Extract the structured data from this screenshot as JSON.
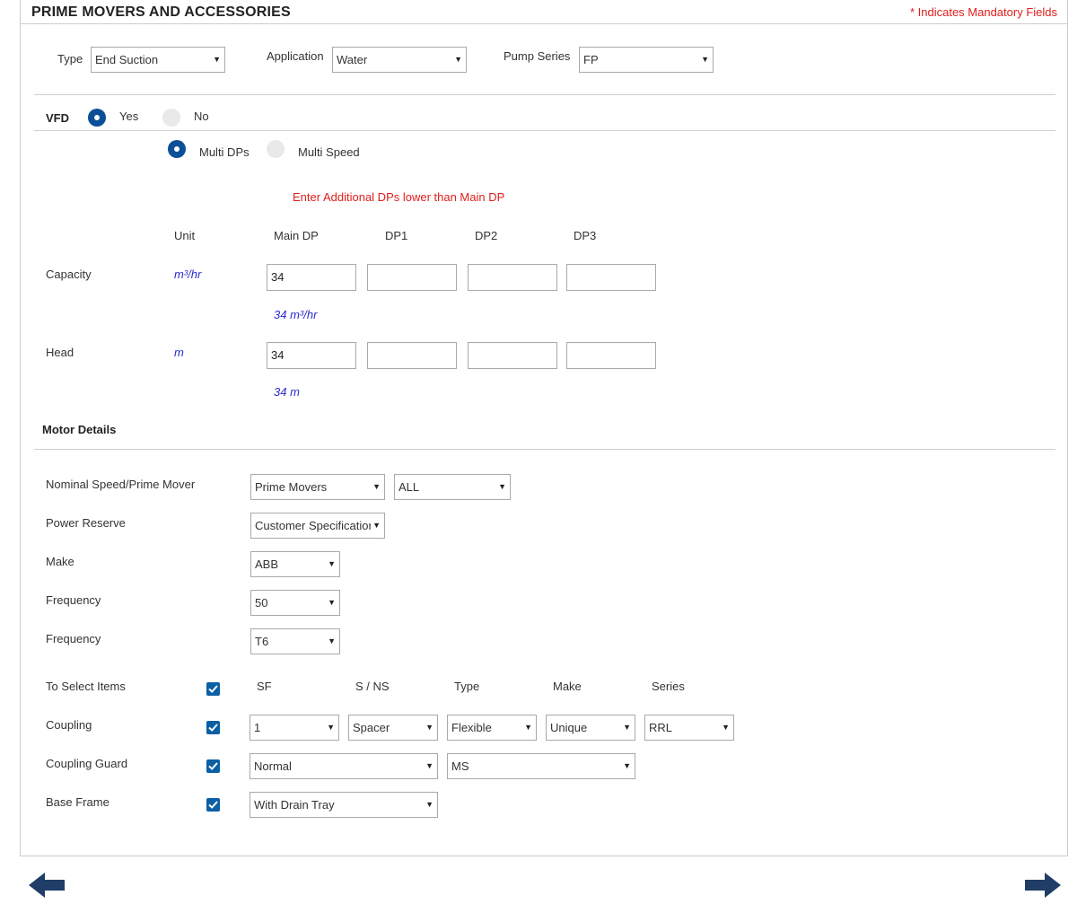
{
  "header": {
    "title": "PRIME MOVERS AND ACCESSORIES",
    "mandatory_note": "* Indicates Mandatory Fields"
  },
  "filters": {
    "type": {
      "label": "Type",
      "value": "End Suction"
    },
    "application": {
      "label": "Application",
      "value": "Water"
    },
    "pump_series": {
      "label": "Pump Series",
      "value": "FP"
    }
  },
  "vfd": {
    "label": "VFD",
    "yes_label": "Yes",
    "no_label": "No",
    "selected": "Yes",
    "mode_multi_dps": "Multi DPs",
    "mode_multi_speed": "Multi Speed",
    "mode_selected": "Multi DPs"
  },
  "dp_table": {
    "warning": "Enter Additional DPs lower than Main DP",
    "headers": {
      "unit": "Unit",
      "main": "Main DP",
      "dp1": "DP1",
      "dp2": "DP2",
      "dp3": "DP3"
    },
    "capacity": {
      "label": "Capacity",
      "unit": "m³/hr",
      "main": "34",
      "dp1": "",
      "dp2": "",
      "dp3": "",
      "hint": "34 m³/hr"
    },
    "head": {
      "label": "Head",
      "unit": "m",
      "main": "34",
      "dp1": "",
      "dp2": "",
      "dp3": "",
      "hint": "34 m"
    }
  },
  "motor": {
    "section_title": "Motor Details",
    "nominal_speed": {
      "label": "Nominal Speed/Prime Mover",
      "value1": "Prime Movers",
      "value2": "ALL"
    },
    "power_reserve": {
      "label": "Power Reserve",
      "value": "Customer Specification"
    },
    "make": {
      "label": "Make",
      "value": "ABB"
    },
    "frequency": {
      "label": "Frequency",
      "value": "50"
    },
    "frequency2": {
      "label": "Frequency",
      "value": "T6"
    }
  },
  "accessories": {
    "select_label": "To Select Items",
    "headers": {
      "sf": "SF",
      "sns": "S / NS",
      "type": "Type",
      "make": "Make",
      "series": "Series"
    },
    "coupling": {
      "label": "Coupling",
      "checked": true,
      "sf": "1",
      "sns": "Spacer",
      "type": "Flexible",
      "make": "Unique",
      "series": "RRL"
    },
    "coupling_guard": {
      "label": "Coupling Guard",
      "checked": true,
      "value1": "Normal",
      "value2": "MS"
    },
    "base_frame": {
      "label": "Base Frame",
      "checked": true,
      "value": "With Drain Tray"
    }
  },
  "icons": {
    "back": "left-arrow-icon",
    "next": "right-arrow-icon",
    "dropdown": "triangle-down-icon",
    "accent_color": "#0b4f97",
    "arrow_color": "#1f3d66",
    "warning_color": "#e0201c"
  }
}
